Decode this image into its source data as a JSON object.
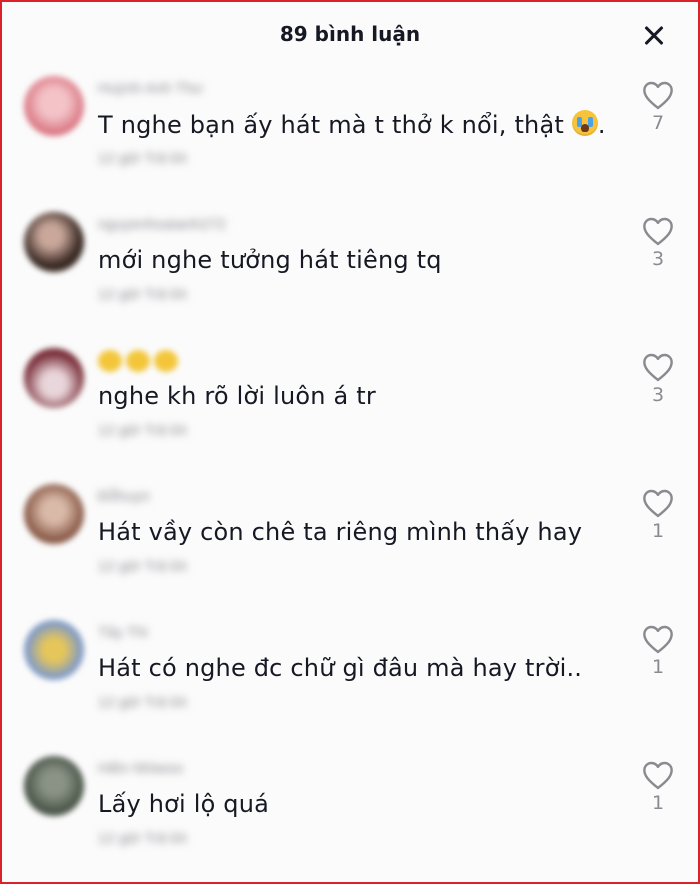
{
  "header": {
    "title": "89 bình luận",
    "close_icon": "close-icon"
  },
  "comments": [
    {
      "username": "Huỳnh Anh Thư",
      "text": "T nghe bạn ấy hát mà t thở k nổi, thật",
      "text_suffix": ".",
      "emoji": "loudly-crying-face",
      "meta": "12 giờ  Trả lời",
      "likes": "7",
      "avatar_color": "#e8a0a8"
    },
    {
      "username": "nguyenhoaianh272",
      "text": "mới nghe tưởng hát tiêng tq",
      "meta": "12 giờ  Trả lời",
      "likes": "3",
      "avatar_color": "#3a2a24"
    },
    {
      "username": "",
      "text": "nghe kh rõ lời luôn á tr",
      "meta": "12 giờ  Trả lời",
      "likes": "3",
      "avatar_color": "#7a2f3a"
    },
    {
      "username": "Đỗhuyn",
      "text": "Hát vầy còn chê ta riêng mình thấy hay",
      "meta": "12 giờ  Trả lời",
      "likes": "1",
      "avatar_color": "#8a5a48"
    },
    {
      "username": "Tây Thi",
      "text": "Hát có nghe đc chữ gì đâu mà hay trời..",
      "meta": "12 giờ  Trả lời",
      "likes": "1",
      "avatar_color": "#7f9ac8"
    },
    {
      "username": "Hiền Nhiwoo",
      "text": "Lấy hơi lộ quá",
      "meta": "12 giờ  Trả lời",
      "likes": "1",
      "avatar_color": "#4a5548"
    }
  ],
  "colors": {
    "border": "#d8232a",
    "text": "#161823",
    "muted": "#8a8b91"
  }
}
